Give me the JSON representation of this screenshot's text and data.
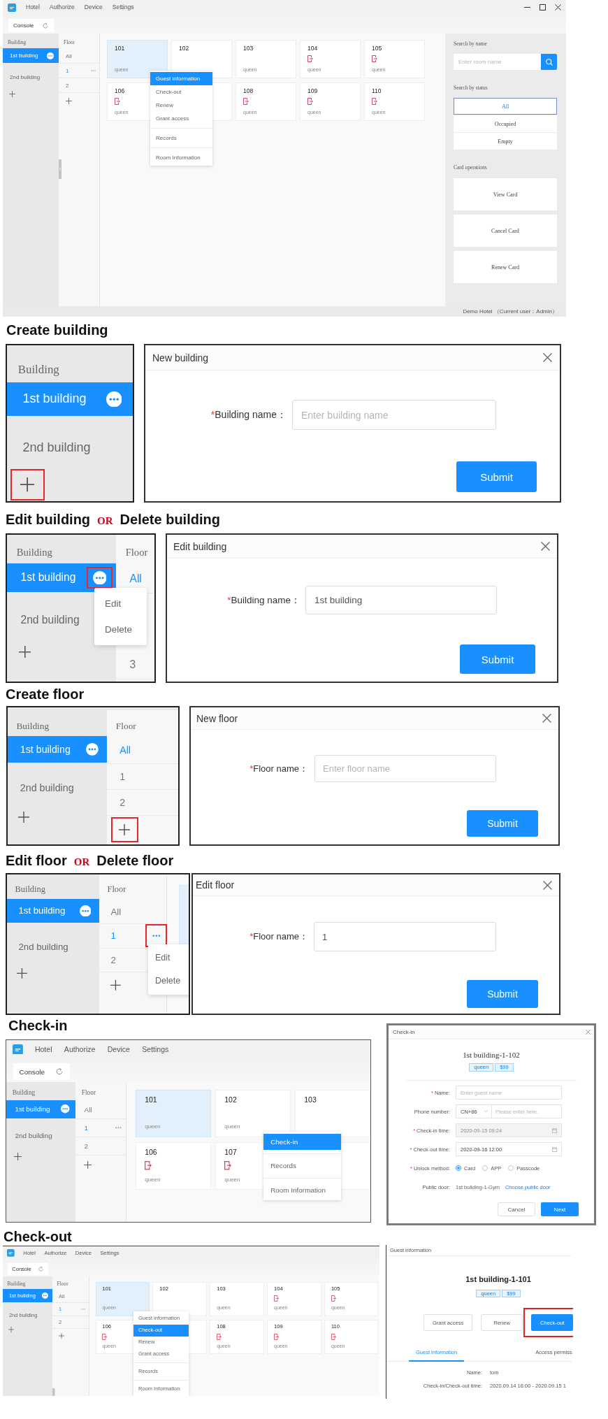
{
  "main_window": {
    "menu": [
      {
        "label": "Hotel"
      },
      {
        "label": "Authorize"
      },
      {
        "label": "Device"
      },
      {
        "label": "Settings"
      }
    ],
    "tabs": [
      {
        "label": "Console"
      }
    ],
    "buildings": {
      "heading": "Building",
      "items": [
        {
          "label": "1st building",
          "selected": true
        },
        {
          "label": "2nd building",
          "selected": false
        }
      ],
      "add": {
        "highlighted": false
      }
    },
    "floors": {
      "heading": "Floor",
      "items": [
        {
          "label": "All",
          "selected": false,
          "more_icon": false
        },
        {
          "label": "1",
          "selected": true,
          "more_icon": true
        },
        {
          "label": "2",
          "selected": false,
          "more_icon": false
        }
      ],
      "add": {
        "highlighted": false
      }
    },
    "room_rows": [
      [
        {
          "number": "101",
          "type": "queen",
          "door_icon": false,
          "selected": true
        },
        {
          "number": "102",
          "door_icon": false,
          "selected": false
        },
        {
          "number": "103",
          "type": "queen",
          "door_icon": false,
          "selected": false
        },
        {
          "number": "104",
          "type": "queen",
          "door_icon": true,
          "selected": false
        },
        {
          "number": "105",
          "type": "queen",
          "door_icon": true,
          "selected": false
        }
      ],
      [
        {
          "number": "106",
          "type": "queen",
          "door_icon": true,
          "selected": false
        },
        {
          "selected": false
        },
        {
          "number": "108",
          "type": "queen",
          "door_icon": true,
          "selected": false
        },
        {
          "number": "109",
          "type": "queen",
          "door_icon": true,
          "selected": false
        },
        {
          "number": "110",
          "type": "queen",
          "door_icon": true,
          "selected": false
        }
      ]
    ],
    "context_menu": {
      "groups": [
        {
          "items": [
            {
              "label": "Guest information",
              "selected": true
            },
            {
              "label": "Check-out",
              "selected": false
            },
            {
              "label": "Renew",
              "selected": false
            },
            {
              "label": "Grant access",
              "selected": false
            }
          ]
        },
        {
          "items": [
            {
              "label": "Records",
              "selected": false
            }
          ]
        },
        {
          "items": [
            {
              "label": "Room Information",
              "selected": false
            }
          ]
        }
      ]
    },
    "right_panel": {
      "search": {
        "label": "Search by name",
        "placeholder": "Enter room name"
      },
      "status_filter": {
        "label": "Search by status",
        "options": [
          {
            "label": "All",
            "selected": true
          },
          {
            "label": "Occupied",
            "selected": false
          },
          {
            "label": "Empty",
            "selected": false
          }
        ]
      },
      "card_operations": {
        "label": "Card operations",
        "buttons": [
          {
            "label": "View Card"
          },
          {
            "label": "Cancel Card"
          },
          {
            "label": "Renew Card"
          }
        ]
      }
    },
    "status_bar": "Demo Hotel （Current user：Admin）"
  },
  "sections": [
    {
      "kind": "create_building",
      "heading": [
        {
          "text": "Create building",
          "kind": "title"
        }
      ],
      "crop": {
        "buildings": {
          "heading": "Building",
          "items": [
            {
              "label": "1st building",
              "selected": true
            },
            {
              "label": "2nd building",
              "selected": false
            }
          ],
          "add": {
            "highlighted": true
          }
        }
      },
      "dialog": {
        "title": "New building",
        "fields": [
          {
            "kind": "text",
            "required_mark": "*",
            "label": "Building name：",
            "placeholder": "Enter building name"
          }
        ],
        "buttons": [
          {
            "label": "Submit",
            "kind": "primary"
          }
        ]
      }
    },
    {
      "kind": "edit_building",
      "heading": [
        {
          "text": "Edit building",
          "kind": "title"
        },
        {
          "text": "OR",
          "kind": "conjunction"
        },
        {
          "text": "Delete building",
          "kind": "title"
        }
      ],
      "crop": {
        "buildings": {
          "heading": "Building",
          "items": [
            {
              "label": "1st building",
              "selected": true,
              "more_highlighted": true
            },
            {
              "label": "2nd building",
              "selected": false
            }
          ],
          "add": {
            "highlighted": false
          }
        },
        "floors": {
          "heading": "Floor",
          "items": [
            {
              "label": "All",
              "selected": true,
              "more_icon": false
            },
            {
              "label": "3",
              "selected": false,
              "more_icon": false
            }
          ]
        },
        "popover": {
          "items": [
            {
              "label": "Edit"
            },
            {
              "label": "Delete"
            }
          ]
        }
      },
      "dialog": {
        "title": "Edit building",
        "fields": [
          {
            "kind": "text",
            "required_mark": "*",
            "label": "Building name：",
            "value": "1st building"
          }
        ],
        "buttons": [
          {
            "label": "Submit",
            "kind": "primary"
          }
        ]
      }
    },
    {
      "kind": "create_floor",
      "heading": [
        {
          "text": "Create floor",
          "kind": "title"
        }
      ],
      "crop": {
        "buildings": {
          "heading": "Building",
          "items": [
            {
              "label": "1st building",
              "selected": true
            },
            {
              "label": "2nd building",
              "selected": false
            }
          ],
          "add": {
            "highlighted": false
          }
        },
        "floors": {
          "heading": "Floor",
          "items": [
            {
              "label": "All",
              "selected": true,
              "more_icon": false
            },
            {
              "label": "1",
              "selected": false,
              "more_icon": false
            },
            {
              "label": "2",
              "selected": false,
              "more_icon": false
            }
          ],
          "add": {
            "highlighted": true
          }
        }
      },
      "dialog": {
        "title": "New floor",
        "fields": [
          {
            "kind": "text",
            "required_mark": "*",
            "label": "Floor name：",
            "placeholder": "Enter floor name"
          }
        ],
        "buttons": [
          {
            "label": "Submit",
            "kind": "primary"
          }
        ]
      }
    },
    {
      "kind": "edit_floor",
      "heading": [
        {
          "text": "Edit floor",
          "kind": "title"
        },
        {
          "text": "OR",
          "kind": "conjunction"
        },
        {
          "text": "Delete floor",
          "kind": "title"
        }
      ],
      "crop": {
        "buildings": {
          "heading": "Building",
          "items": [
            {
              "label": "1st building",
              "selected": true
            },
            {
              "label": "2nd building",
              "selected": false
            }
          ],
          "add": {
            "highlighted": false
          }
        },
        "floors": {
          "heading": "Floor",
          "items": [
            {
              "label": "All",
              "selected": false,
              "more_icon": false
            },
            {
              "label": "1",
              "selected": true,
              "more_icon": true,
              "more_highlighted": true
            },
            {
              "label": "2",
              "selected": false,
              "more_icon": false
            }
          ],
          "add": {
            "highlighted": false
          }
        },
        "room_rows": [
          [
            {
              "selected": true
            }
          ]
        ],
        "popover": {
          "items": [
            {
              "label": "Edit"
            },
            {
              "label": "Delete"
            }
          ]
        }
      },
      "dialog": {
        "title": "Edit floor",
        "fields": [
          {
            "kind": "text",
            "required_mark": "*",
            "label": "Floor name：",
            "value": "1"
          }
        ],
        "buttons": [
          {
            "label": "Submit",
            "kind": "primary"
          }
        ]
      }
    },
    {
      "kind": "check_in",
      "heading": [
        {
          "text": "Check-in",
          "kind": "title"
        }
      ],
      "window": {
        "menu": [
          {
            "label": "Hotel"
          },
          {
            "label": "Authorize"
          },
          {
            "label": "Device"
          },
          {
            "label": "Settings"
          }
        ],
        "tabs": [
          {
            "label": "Console"
          }
        ],
        "buildings": {
          "heading": "Building",
          "items": [
            {
              "label": "1st building",
              "selected": true
            },
            {
              "label": "2nd building",
              "selected": false
            }
          ],
          "add": {
            "highlighted": false
          }
        },
        "floors": {
          "heading": "Floor",
          "items": [
            {
              "label": "All",
              "selected": false,
              "more_icon": false
            },
            {
              "label": "1",
              "selected": true,
              "more_icon": true
            },
            {
              "label": "2",
              "selected": false,
              "more_icon": false
            }
          ],
          "add": {
            "highlighted": false
          }
        },
        "room_rows": [
          [
            {
              "number": "101",
              "type": "queen",
              "door_icon": false,
              "selected": true
            },
            {
              "number": "102",
              "type": "queen",
              "door_icon": false,
              "selected": false
            },
            {
              "number": "103",
              "door_icon": false,
              "selected": false
            }
          ],
          [
            {
              "number": "106",
              "type": "queen",
              "door_icon": true,
              "selected": false
            },
            {
              "number": "107",
              "type": "queen",
              "door_icon": true,
              "selected": false
            },
            {
              "selected": false
            }
          ]
        ],
        "context_menu": {
          "groups": [
            {
              "items": [
                {
                  "label": "Check-in",
                  "selected": true
                }
              ]
            },
            {
              "items": [
                {
                  "label": "Records",
                  "selected": false
                }
              ]
            },
            {
              "items": [
                {
                  "label": "Room Information",
                  "selected": false
                }
              ]
            }
          ]
        }
      },
      "dialog": {
        "title": "Check-in",
        "room_title": "1st building-1-102",
        "tags": [
          {
            "label": "queen"
          },
          {
            "label": "$99"
          }
        ],
        "fields": [
          {
            "kind": "text",
            "required_mark": "*",
            "label": "Name:",
            "placeholder": "Enter guest name"
          },
          {
            "kind": "phone",
            "label": "Phone number:",
            "country_code": "CN+86",
            "placeholder": "Please enter here."
          },
          {
            "kind": "date",
            "required_mark": "*",
            "label": "Check-in time:",
            "value": "2020-09-15 09:24",
            "disabled": true
          },
          {
            "kind": "date",
            "required_mark": "*",
            "label": "Check-out time:",
            "value": "2020-09-16 12:00",
            "disabled": false
          },
          {
            "kind": "radio",
            "required_mark": "*",
            "label": "Unlock method:",
            "options": [
              {
                "label": "Card",
                "selected": true
              },
              {
                "label": "APP",
                "selected": false
              },
              {
                "label": "Passcode",
                "selected": false
              }
            ]
          },
          {
            "kind": "text_link",
            "label": "Public door:",
            "value": "1st building-1-Gym",
            "link": "Choose public door"
          }
        ],
        "buttons": [
          {
            "label": "Cancel",
            "kind": "default"
          },
          {
            "label": "Next",
            "kind": "primary"
          }
        ]
      }
    },
    {
      "kind": "check_out",
      "heading": [
        {
          "text": "Check-out",
          "kind": "title"
        }
      ],
      "window": {
        "menu": [
          {
            "label": "Hotel"
          },
          {
            "label": "Authorize"
          },
          {
            "label": "Device"
          },
          {
            "label": "Settings"
          }
        ],
        "tabs": [
          {
            "label": "Console"
          }
        ],
        "buildings": {
          "heading": "Building",
          "items": [
            {
              "label": "1st building",
              "selected": true
            },
            {
              "label": "2nd building",
              "selected": false
            }
          ],
          "add": {
            "highlighted": false
          }
        },
        "floors": {
          "heading": "Floor",
          "items": [
            {
              "label": "All",
              "selected": false,
              "more_icon": false
            },
            {
              "label": "1",
              "selected": true,
              "more_icon": true
            },
            {
              "label": "2",
              "selected": false,
              "more_icon": false
            }
          ],
          "add": {
            "highlighted": false
          }
        },
        "room_rows": [
          [
            {
              "number": "101",
              "type": "queen",
              "door_icon": false,
              "selected": true
            },
            {
              "number": "102",
              "door_icon": false,
              "selected": false
            },
            {
              "number": "103",
              "type": "queen",
              "door_icon": false,
              "selected": false
            },
            {
              "number": "104",
              "type": "queen",
              "door_icon": true,
              "selected": false
            },
            {
              "number": "105",
              "type": "queen",
              "door_icon": true,
              "selected": false
            }
          ],
          [
            {
              "number": "106",
              "type": "queen",
              "door_icon": true,
              "selected": false
            },
            {
              "selected": false
            },
            {
              "number": "108",
              "type": "queen",
              "door_icon": true,
              "selected": false
            },
            {
              "number": "109",
              "type": "queen",
              "door_icon": true,
              "selected": false
            },
            {
              "number": "110",
              "type": "queen",
              "door_icon": true,
              "selected": false
            }
          ]
        ],
        "context_menu": {
          "groups": [
            {
              "items": [
                {
                  "label": "Guest information",
                  "selected": false
                },
                {
                  "label": "Check-out",
                  "selected": true
                },
                {
                  "label": "Renew",
                  "selected": false
                },
                {
                  "label": "Grant access",
                  "selected": false
                }
              ]
            },
            {
              "items": [
                {
                  "label": "Records",
                  "selected": false
                }
              ]
            },
            {
              "items": [
                {
                  "label": "Room Information",
                  "selected": false
                }
              ]
            }
          ]
        }
      },
      "guest_panel": {
        "title": "Guest information",
        "room_title": "1st building-1-101",
        "tags": [
          {
            "label": "queen"
          },
          {
            "label": "$99"
          }
        ],
        "buttons": [
          {
            "label": "Grant access",
            "kind": "default"
          },
          {
            "label": "Renew",
            "kind": "default"
          },
          {
            "label": "Check-out",
            "kind": "primary",
            "highlighted": true
          }
        ],
        "tabs": [
          {
            "label": "Guest information",
            "selected": true
          },
          {
            "label": "Access permiss",
            "selected": false
          }
        ],
        "details": [
          {
            "label": "Name:",
            "value": "tom"
          },
          {
            "label": "Check-in/Check-out time:",
            "value": "2020.09.14 16:00 - 2020.09.15 1"
          }
        ]
      }
    }
  ]
}
